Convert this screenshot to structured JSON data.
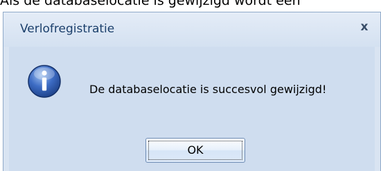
{
  "page": {
    "caption": "Als de databaselocatie is gewijzigd wordt een"
  },
  "dialog": {
    "title": "Verlofregistratie",
    "close_label": "x",
    "icon": "info-icon",
    "message": "De databaselocatie is succesvol gewijzigd!",
    "ok_label": "OK"
  },
  "colors": {
    "titlebar": "#d4e1f1",
    "title_text": "#1b3f6b",
    "body_background": "#cfddef",
    "icon_blue": "#2b58a6"
  }
}
